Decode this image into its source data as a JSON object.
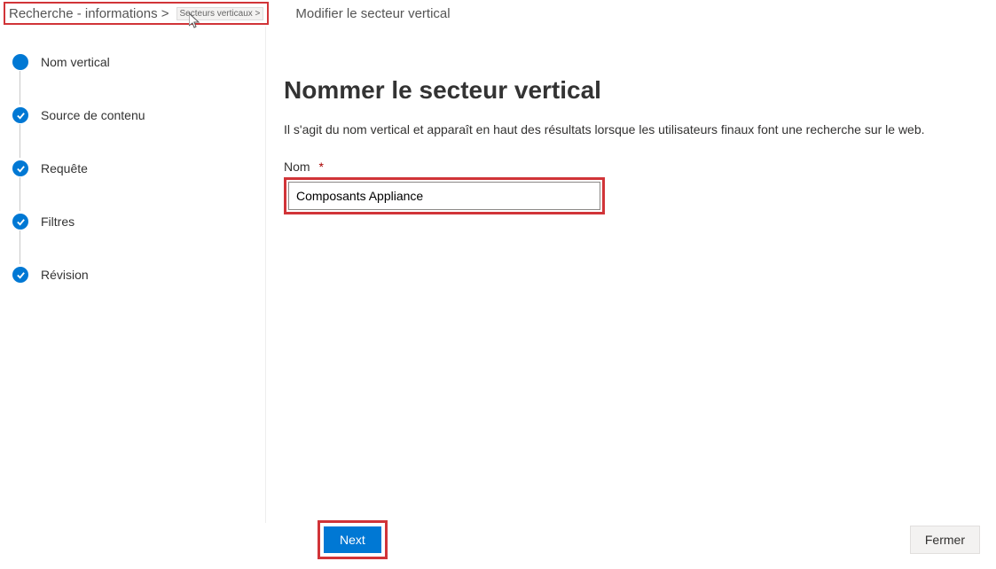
{
  "breadcrumb": {
    "item1": "Recherche - informations >",
    "item2": "Secteurs verticaux >",
    "title": "Modifier le secteur vertical"
  },
  "sidebar": {
    "steps": [
      {
        "label": "Nom vertical",
        "state": "current"
      },
      {
        "label": "Source de contenu",
        "state": "done"
      },
      {
        "label": "Requête",
        "state": "done"
      },
      {
        "label": "Filtres",
        "state": "done"
      },
      {
        "label": "Révision",
        "state": "done"
      }
    ]
  },
  "content": {
    "heading": "Nommer le secteur vertical",
    "description": "Il s'agit du nom vertical et apparaît en haut des résultats lorsque les utilisateurs finaux font une recherche sur le web.",
    "name_label": "Nom",
    "required_marker": "*",
    "name_value": "Composants Appliance"
  },
  "footer": {
    "next": "Next",
    "close": "Fermer"
  }
}
